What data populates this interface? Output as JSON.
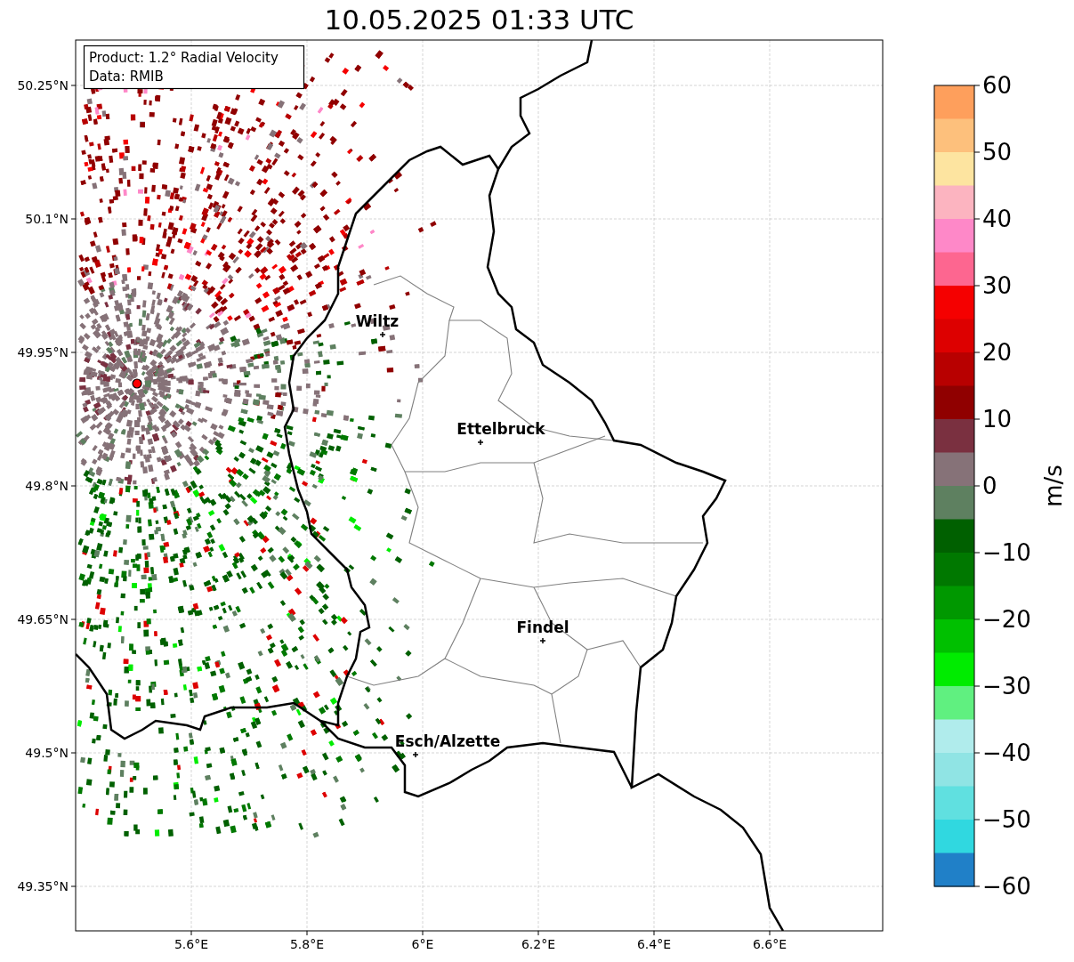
{
  "title": "10.05.2025 01:33 UTC",
  "legend": [
    "Product: 1.2° Radial Velocity",
    "Data: RMIB"
  ],
  "map": {
    "lat_ticks": [
      "50.25°N",
      "50.1°N",
      "49.95°N",
      "49.8°N",
      "49.65°N",
      "49.5°N",
      "49.35°N"
    ],
    "lon_ticks": [
      "5.6°E",
      "5.8°E",
      "6°E",
      "6.2°E",
      "6.4°E",
      "6.6°E"
    ],
    "cities": [
      {
        "name": "Wiltz"
      },
      {
        "name": "Ettelbruck"
      },
      {
        "name": "Findel"
      },
      {
        "name": "Esch/Alzette"
      }
    ]
  },
  "colorbar": {
    "label": "m/s",
    "ticks": [
      "60",
      "50",
      "40",
      "30",
      "20",
      "10",
      "0",
      "−10",
      "−20",
      "−30",
      "−40",
      "−50",
      "−60"
    ],
    "segments": [
      {
        "color": "#fe9f5c"
      },
      {
        "color": "#fdc07c"
      },
      {
        "color": "#fde4a0"
      },
      {
        "color": "#fcb4c0"
      },
      {
        "color": "#fe88c8"
      },
      {
        "color": "#fd6690"
      },
      {
        "color": "#f50000"
      },
      {
        "color": "#dd0000"
      },
      {
        "color": "#b80000"
      },
      {
        "color": "#900000"
      },
      {
        "color": "#7a3040"
      },
      {
        "color": "#867278"
      },
      {
        "color": "#5e8060"
      },
      {
        "color": "#006000"
      },
      {
        "color": "#007800"
      },
      {
        "color": "#009800"
      },
      {
        "color": "#00c000"
      },
      {
        "color": "#00ec00"
      },
      {
        "color": "#60f080"
      },
      {
        "color": "#b0ecec"
      },
      {
        "color": "#90e4e4"
      },
      {
        "color": "#60e0e0"
      },
      {
        "color": "#30d8e0"
      },
      {
        "color": "#2080c8"
      }
    ]
  }
}
